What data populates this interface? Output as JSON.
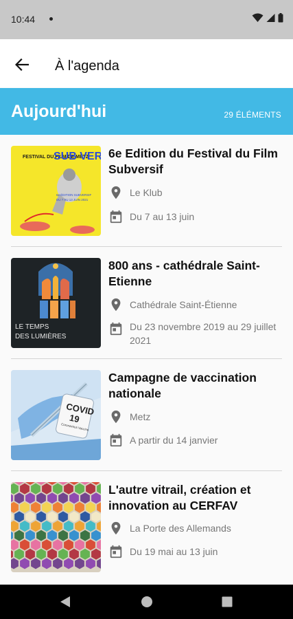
{
  "status_bar": {
    "time": "10:44"
  },
  "app_bar": {
    "title": "À l'agenda"
  },
  "section": {
    "title": "Aujourd'hui",
    "count": "29 ÉLÉMENTS"
  },
  "events": [
    {
      "title": "6e Edition du Festival du Film Subversif",
      "location": "Le Klub",
      "date": "Du 7 au 13 juin",
      "thumb_text": {
        "left": "FESTIVAL DU FILM DE METZ",
        "right": "SUB VER SIF",
        "small": "6e ÉDITION SUBVERSIF",
        "dates": "DU 7 AU 13 JUIN 2021"
      }
    },
    {
      "title": "800 ans - cathédrale Saint-Etienne",
      "location": "Cathédrale Saint-Étienne",
      "date": "Du 23 novembre 2019 au 29 juillet 2021",
      "thumb_text": {
        "line1": "LE TEMPS",
        "line2": "DES LUMIÈRES"
      }
    },
    {
      "title": "Campagne de vaccination nationale",
      "location": "Metz",
      "date": "A partir du 14 janvier",
      "thumb_text": {
        "line1": "COVID",
        "line2": "19",
        "line3": "Coronavirus Vaccine"
      }
    },
    {
      "title": "L'autre vitrail, création et innovation au CERFAV",
      "location": "La Porte des Allemands",
      "date": "Du 19 mai au 13 juin"
    }
  ],
  "colors": {
    "accent": "#42b9e5",
    "status_bar": "#c8c8c8",
    "app_bar": "#ffffff",
    "background": "#fafafa"
  }
}
